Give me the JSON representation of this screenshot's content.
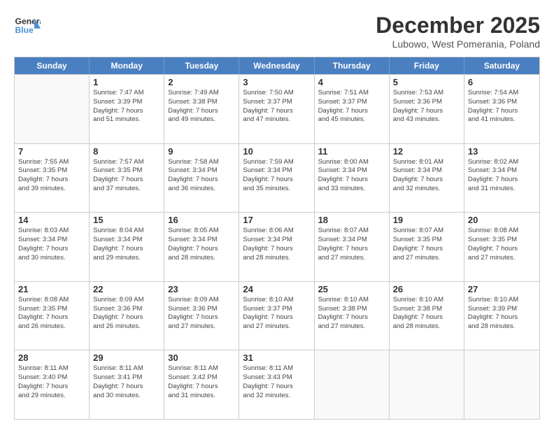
{
  "header": {
    "logo_line1": "General",
    "logo_line2": "Blue",
    "month": "December 2025",
    "location": "Lubowo, West Pomerania, Poland"
  },
  "days_of_week": [
    "Sunday",
    "Monday",
    "Tuesday",
    "Wednesday",
    "Thursday",
    "Friday",
    "Saturday"
  ],
  "weeks": [
    [
      {
        "day": "",
        "info": []
      },
      {
        "day": "1",
        "info": [
          "Sunrise: 7:47 AM",
          "Sunset: 3:39 PM",
          "Daylight: 7 hours",
          "and 51 minutes."
        ]
      },
      {
        "day": "2",
        "info": [
          "Sunrise: 7:49 AM",
          "Sunset: 3:38 PM",
          "Daylight: 7 hours",
          "and 49 minutes."
        ]
      },
      {
        "day": "3",
        "info": [
          "Sunrise: 7:50 AM",
          "Sunset: 3:37 PM",
          "Daylight: 7 hours",
          "and 47 minutes."
        ]
      },
      {
        "day": "4",
        "info": [
          "Sunrise: 7:51 AM",
          "Sunset: 3:37 PM",
          "Daylight: 7 hours",
          "and 45 minutes."
        ]
      },
      {
        "day": "5",
        "info": [
          "Sunrise: 7:53 AM",
          "Sunset: 3:36 PM",
          "Daylight: 7 hours",
          "and 43 minutes."
        ]
      },
      {
        "day": "6",
        "info": [
          "Sunrise: 7:54 AM",
          "Sunset: 3:36 PM",
          "Daylight: 7 hours",
          "and 41 minutes."
        ]
      }
    ],
    [
      {
        "day": "7",
        "info": [
          "Sunrise: 7:55 AM",
          "Sunset: 3:35 PM",
          "Daylight: 7 hours",
          "and 39 minutes."
        ]
      },
      {
        "day": "8",
        "info": [
          "Sunrise: 7:57 AM",
          "Sunset: 3:35 PM",
          "Daylight: 7 hours",
          "and 37 minutes."
        ]
      },
      {
        "day": "9",
        "info": [
          "Sunrise: 7:58 AM",
          "Sunset: 3:34 PM",
          "Daylight: 7 hours",
          "and 36 minutes."
        ]
      },
      {
        "day": "10",
        "info": [
          "Sunrise: 7:59 AM",
          "Sunset: 3:34 PM",
          "Daylight: 7 hours",
          "and 35 minutes."
        ]
      },
      {
        "day": "11",
        "info": [
          "Sunrise: 8:00 AM",
          "Sunset: 3:34 PM",
          "Daylight: 7 hours",
          "and 33 minutes."
        ]
      },
      {
        "day": "12",
        "info": [
          "Sunrise: 8:01 AM",
          "Sunset: 3:34 PM",
          "Daylight: 7 hours",
          "and 32 minutes."
        ]
      },
      {
        "day": "13",
        "info": [
          "Sunrise: 8:02 AM",
          "Sunset: 3:34 PM",
          "Daylight: 7 hours",
          "and 31 minutes."
        ]
      }
    ],
    [
      {
        "day": "14",
        "info": [
          "Sunrise: 8:03 AM",
          "Sunset: 3:34 PM",
          "Daylight: 7 hours",
          "and 30 minutes."
        ]
      },
      {
        "day": "15",
        "info": [
          "Sunrise: 8:04 AM",
          "Sunset: 3:34 PM",
          "Daylight: 7 hours",
          "and 29 minutes."
        ]
      },
      {
        "day": "16",
        "info": [
          "Sunrise: 8:05 AM",
          "Sunset: 3:34 PM",
          "Daylight: 7 hours",
          "and 28 minutes."
        ]
      },
      {
        "day": "17",
        "info": [
          "Sunrise: 8:06 AM",
          "Sunset: 3:34 PM",
          "Daylight: 7 hours",
          "and 28 minutes."
        ]
      },
      {
        "day": "18",
        "info": [
          "Sunrise: 8:07 AM",
          "Sunset: 3:34 PM",
          "Daylight: 7 hours",
          "and 27 minutes."
        ]
      },
      {
        "day": "19",
        "info": [
          "Sunrise: 8:07 AM",
          "Sunset: 3:35 PM",
          "Daylight: 7 hours",
          "and 27 minutes."
        ]
      },
      {
        "day": "20",
        "info": [
          "Sunrise: 8:08 AM",
          "Sunset: 3:35 PM",
          "Daylight: 7 hours",
          "and 27 minutes."
        ]
      }
    ],
    [
      {
        "day": "21",
        "info": [
          "Sunrise: 8:08 AM",
          "Sunset: 3:35 PM",
          "Daylight: 7 hours",
          "and 26 minutes."
        ]
      },
      {
        "day": "22",
        "info": [
          "Sunrise: 8:09 AM",
          "Sunset: 3:36 PM",
          "Daylight: 7 hours",
          "and 26 minutes."
        ]
      },
      {
        "day": "23",
        "info": [
          "Sunrise: 8:09 AM",
          "Sunset: 3:36 PM",
          "Daylight: 7 hours",
          "and 27 minutes."
        ]
      },
      {
        "day": "24",
        "info": [
          "Sunrise: 8:10 AM",
          "Sunset: 3:37 PM",
          "Daylight: 7 hours",
          "and 27 minutes."
        ]
      },
      {
        "day": "25",
        "info": [
          "Sunrise: 8:10 AM",
          "Sunset: 3:38 PM",
          "Daylight: 7 hours",
          "and 27 minutes."
        ]
      },
      {
        "day": "26",
        "info": [
          "Sunrise: 8:10 AM",
          "Sunset: 3:38 PM",
          "Daylight: 7 hours",
          "and 28 minutes."
        ]
      },
      {
        "day": "27",
        "info": [
          "Sunrise: 8:10 AM",
          "Sunset: 3:39 PM",
          "Daylight: 7 hours",
          "and 28 minutes."
        ]
      }
    ],
    [
      {
        "day": "28",
        "info": [
          "Sunrise: 8:11 AM",
          "Sunset: 3:40 PM",
          "Daylight: 7 hours",
          "and 29 minutes."
        ]
      },
      {
        "day": "29",
        "info": [
          "Sunrise: 8:11 AM",
          "Sunset: 3:41 PM",
          "Daylight: 7 hours",
          "and 30 minutes."
        ]
      },
      {
        "day": "30",
        "info": [
          "Sunrise: 8:11 AM",
          "Sunset: 3:42 PM",
          "Daylight: 7 hours",
          "and 31 minutes."
        ]
      },
      {
        "day": "31",
        "info": [
          "Sunrise: 8:11 AM",
          "Sunset: 3:43 PM",
          "Daylight: 7 hours",
          "and 32 minutes."
        ]
      },
      {
        "day": "",
        "info": []
      },
      {
        "day": "",
        "info": []
      },
      {
        "day": "",
        "info": []
      }
    ]
  ]
}
